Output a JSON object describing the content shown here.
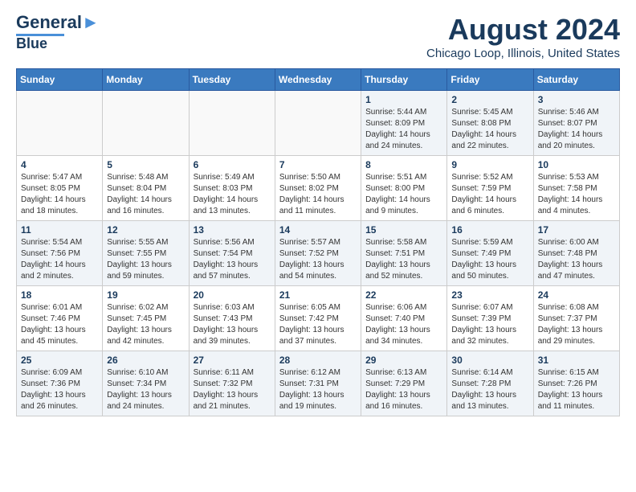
{
  "logo": {
    "line1": "General",
    "line2": "Blue"
  },
  "header": {
    "month": "August 2024",
    "location": "Chicago Loop, Illinois, United States"
  },
  "weekdays": [
    "Sunday",
    "Monday",
    "Tuesday",
    "Wednesday",
    "Thursday",
    "Friday",
    "Saturday"
  ],
  "weeks": [
    [
      {
        "day": "",
        "info": ""
      },
      {
        "day": "",
        "info": ""
      },
      {
        "day": "",
        "info": ""
      },
      {
        "day": "",
        "info": ""
      },
      {
        "day": "1",
        "info": "Sunrise: 5:44 AM\nSunset: 8:09 PM\nDaylight: 14 hours\nand 24 minutes."
      },
      {
        "day": "2",
        "info": "Sunrise: 5:45 AM\nSunset: 8:08 PM\nDaylight: 14 hours\nand 22 minutes."
      },
      {
        "day": "3",
        "info": "Sunrise: 5:46 AM\nSunset: 8:07 PM\nDaylight: 14 hours\nand 20 minutes."
      }
    ],
    [
      {
        "day": "4",
        "info": "Sunrise: 5:47 AM\nSunset: 8:05 PM\nDaylight: 14 hours\nand 18 minutes."
      },
      {
        "day": "5",
        "info": "Sunrise: 5:48 AM\nSunset: 8:04 PM\nDaylight: 14 hours\nand 16 minutes."
      },
      {
        "day": "6",
        "info": "Sunrise: 5:49 AM\nSunset: 8:03 PM\nDaylight: 14 hours\nand 13 minutes."
      },
      {
        "day": "7",
        "info": "Sunrise: 5:50 AM\nSunset: 8:02 PM\nDaylight: 14 hours\nand 11 minutes."
      },
      {
        "day": "8",
        "info": "Sunrise: 5:51 AM\nSunset: 8:00 PM\nDaylight: 14 hours\nand 9 minutes."
      },
      {
        "day": "9",
        "info": "Sunrise: 5:52 AM\nSunset: 7:59 PM\nDaylight: 14 hours\nand 6 minutes."
      },
      {
        "day": "10",
        "info": "Sunrise: 5:53 AM\nSunset: 7:58 PM\nDaylight: 14 hours\nand 4 minutes."
      }
    ],
    [
      {
        "day": "11",
        "info": "Sunrise: 5:54 AM\nSunset: 7:56 PM\nDaylight: 14 hours\nand 2 minutes."
      },
      {
        "day": "12",
        "info": "Sunrise: 5:55 AM\nSunset: 7:55 PM\nDaylight: 13 hours\nand 59 minutes."
      },
      {
        "day": "13",
        "info": "Sunrise: 5:56 AM\nSunset: 7:54 PM\nDaylight: 13 hours\nand 57 minutes."
      },
      {
        "day": "14",
        "info": "Sunrise: 5:57 AM\nSunset: 7:52 PM\nDaylight: 13 hours\nand 54 minutes."
      },
      {
        "day": "15",
        "info": "Sunrise: 5:58 AM\nSunset: 7:51 PM\nDaylight: 13 hours\nand 52 minutes."
      },
      {
        "day": "16",
        "info": "Sunrise: 5:59 AM\nSunset: 7:49 PM\nDaylight: 13 hours\nand 50 minutes."
      },
      {
        "day": "17",
        "info": "Sunrise: 6:00 AM\nSunset: 7:48 PM\nDaylight: 13 hours\nand 47 minutes."
      }
    ],
    [
      {
        "day": "18",
        "info": "Sunrise: 6:01 AM\nSunset: 7:46 PM\nDaylight: 13 hours\nand 45 minutes."
      },
      {
        "day": "19",
        "info": "Sunrise: 6:02 AM\nSunset: 7:45 PM\nDaylight: 13 hours\nand 42 minutes."
      },
      {
        "day": "20",
        "info": "Sunrise: 6:03 AM\nSunset: 7:43 PM\nDaylight: 13 hours\nand 39 minutes."
      },
      {
        "day": "21",
        "info": "Sunrise: 6:05 AM\nSunset: 7:42 PM\nDaylight: 13 hours\nand 37 minutes."
      },
      {
        "day": "22",
        "info": "Sunrise: 6:06 AM\nSunset: 7:40 PM\nDaylight: 13 hours\nand 34 minutes."
      },
      {
        "day": "23",
        "info": "Sunrise: 6:07 AM\nSunset: 7:39 PM\nDaylight: 13 hours\nand 32 minutes."
      },
      {
        "day": "24",
        "info": "Sunrise: 6:08 AM\nSunset: 7:37 PM\nDaylight: 13 hours\nand 29 minutes."
      }
    ],
    [
      {
        "day": "25",
        "info": "Sunrise: 6:09 AM\nSunset: 7:36 PM\nDaylight: 13 hours\nand 26 minutes."
      },
      {
        "day": "26",
        "info": "Sunrise: 6:10 AM\nSunset: 7:34 PM\nDaylight: 13 hours\nand 24 minutes."
      },
      {
        "day": "27",
        "info": "Sunrise: 6:11 AM\nSunset: 7:32 PM\nDaylight: 13 hours\nand 21 minutes."
      },
      {
        "day": "28",
        "info": "Sunrise: 6:12 AM\nSunset: 7:31 PM\nDaylight: 13 hours\nand 19 minutes."
      },
      {
        "day": "29",
        "info": "Sunrise: 6:13 AM\nSunset: 7:29 PM\nDaylight: 13 hours\nand 16 minutes."
      },
      {
        "day": "30",
        "info": "Sunrise: 6:14 AM\nSunset: 7:28 PM\nDaylight: 13 hours\nand 13 minutes."
      },
      {
        "day": "31",
        "info": "Sunrise: 6:15 AM\nSunset: 7:26 PM\nDaylight: 13 hours\nand 11 minutes."
      }
    ]
  ]
}
